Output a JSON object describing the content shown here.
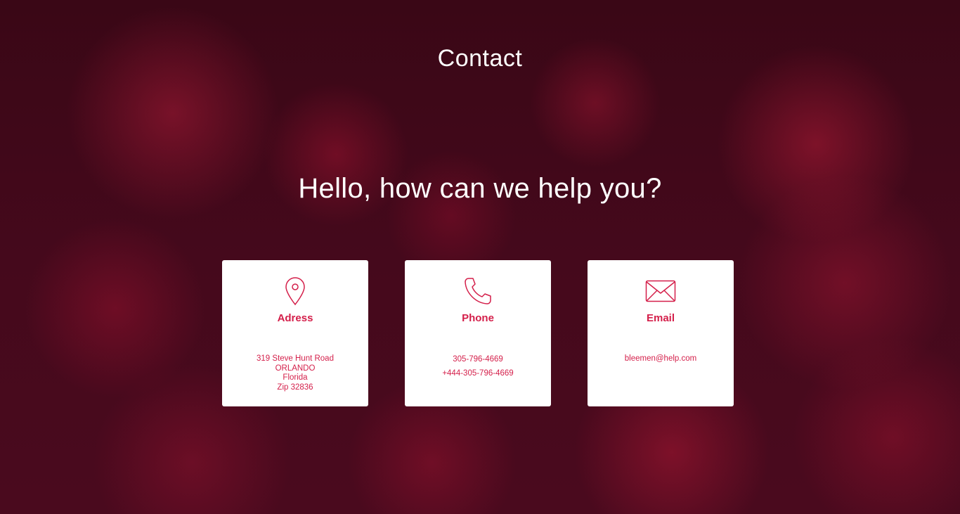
{
  "page": {
    "title": "Contact",
    "headline": "Hello, how can we help you?"
  },
  "colors": {
    "accent": "#d41f4a",
    "card_bg": "#ffffff",
    "background": "#3b0a18"
  },
  "cards": [
    {
      "icon": "map-pin-icon",
      "title": "Adress",
      "lines": [
        "319 Steve Hunt Road",
        "ORLANDO",
        "Florida",
        "Zip 32836"
      ]
    },
    {
      "icon": "phone-icon",
      "title": "Phone",
      "lines": [
        "305-796-4669",
        "+444-305-796-4669"
      ]
    },
    {
      "icon": "envelope-icon",
      "title": "Email",
      "lines": [
        "bleemen@help.com"
      ]
    }
  ]
}
